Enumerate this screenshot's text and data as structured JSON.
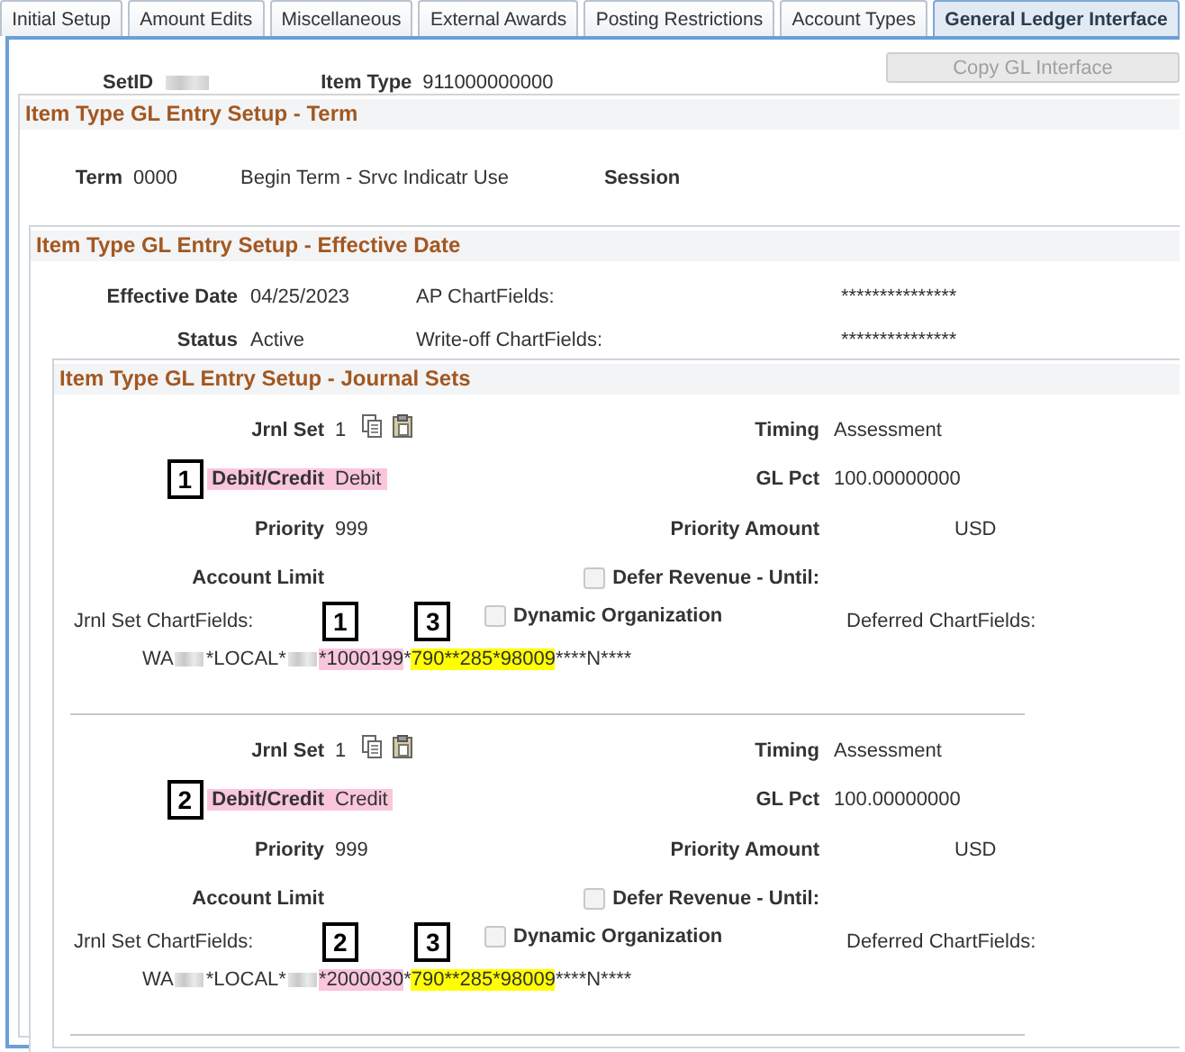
{
  "tabs": [
    {
      "label": "Initial Setup",
      "selected": false
    },
    {
      "label": "Amount Edits",
      "selected": false
    },
    {
      "label": "Miscellaneous",
      "selected": false
    },
    {
      "label": "External Awards",
      "selected": false
    },
    {
      "label": "Posting Restrictions",
      "selected": false
    },
    {
      "label": "Account Types",
      "selected": false
    },
    {
      "label": "General Ledger Interface",
      "selected": true
    }
  ],
  "header": {
    "setid_label": "SetID",
    "item_type_label": "Item Type",
    "item_type": "911000000000",
    "copy_button": {
      "label": "Copy GL Interface",
      "disabled": true
    }
  },
  "term_section": {
    "title": "Item Type GL Entry Setup - Term",
    "term_label": "Term",
    "term": "0000",
    "term_description": "Begin Term - Srvc Indicatr Use",
    "session_label": "Session"
  },
  "effective_section": {
    "title": "Item Type GL Entry Setup - Effective Date",
    "effective_date_label": "Effective Date",
    "effective_date": "04/25/2023",
    "status_label": "Status",
    "status": "Active",
    "ap_chartfields_label": "AP ChartFields:",
    "ap_chartfields": "***************",
    "writeoff_label": "Write-off ChartFields:",
    "writeoff_chartfields": "***************"
  },
  "journal_section": {
    "title": "Item Type GL Entry Setup - Journal Sets",
    "sets": [
      {
        "jrnl_set_label": "Jrnl Set",
        "jrnl_set": "1",
        "timing_label": "Timing",
        "timing": "Assessment",
        "debit_credit_label": "Debit/Credit",
        "debit_credit": "Debit",
        "debit_credit_callout": "1",
        "gl_pct_label": "GL Pct",
        "gl_pct": "100.00000000",
        "priority_label": "Priority",
        "priority": "999",
        "priority_amount_label": "Priority Amount",
        "priority_amount_currency": "USD",
        "account_limit_label": "Account Limit",
        "defer_revenue": {
          "label": "Defer Revenue - Until:",
          "checked": false
        },
        "chartfields_label": "Jrnl Set ChartFields:",
        "chartfield_callouts": [
          "1",
          "3"
        ],
        "dynamic_organization": {
          "label": "Dynamic Organization",
          "checked": false
        },
        "deferred_label": "Deferred ChartFields:",
        "chartfields": [
          {
            "kind": "plain",
            "text": "WA"
          },
          {
            "kind": "redacted"
          },
          {
            "kind": "plain",
            "text": "*LOCAL*"
          },
          {
            "kind": "redacted"
          },
          {
            "kind": "marked",
            "text": "*1000199",
            "color": "#f9c6dc"
          },
          {
            "kind": "plain",
            "text": "*"
          },
          {
            "kind": "marked",
            "text": "790**285*98009",
            "color": "#ffff00"
          },
          {
            "kind": "plain",
            "text": "****N****"
          }
        ]
      },
      {
        "jrnl_set_label": "Jrnl Set",
        "jrnl_set": "1",
        "timing_label": "Timing",
        "timing": "Assessment",
        "debit_credit_label": "Debit/Credit",
        "debit_credit": "Credit",
        "debit_credit_callout": "2",
        "gl_pct_label": "GL Pct",
        "gl_pct": "100.00000000",
        "priority_label": "Priority",
        "priority": "999",
        "priority_amount_label": "Priority Amount",
        "priority_amount_currency": "USD",
        "account_limit_label": "Account Limit",
        "defer_revenue": {
          "label": "Defer Revenue - Until:",
          "checked": false
        },
        "chartfields_label": "Jrnl Set ChartFields:",
        "chartfield_callouts": [
          "2",
          "3"
        ],
        "dynamic_organization": {
          "label": "Dynamic Organization",
          "checked": false
        },
        "deferred_label": "Deferred ChartFields:",
        "chartfields": [
          {
            "kind": "plain",
            "text": "WA"
          },
          {
            "kind": "redacted"
          },
          {
            "kind": "plain",
            "text": "*LOCAL*"
          },
          {
            "kind": "redacted"
          },
          {
            "kind": "marked",
            "text": "*2000030",
            "color": "#f9c6dc"
          },
          {
            "kind": "plain",
            "text": "*"
          },
          {
            "kind": "marked",
            "text": "790**285*98009",
            "color": "#ffff00"
          },
          {
            "kind": "plain",
            "text": "****N****"
          }
        ]
      }
    ]
  }
}
